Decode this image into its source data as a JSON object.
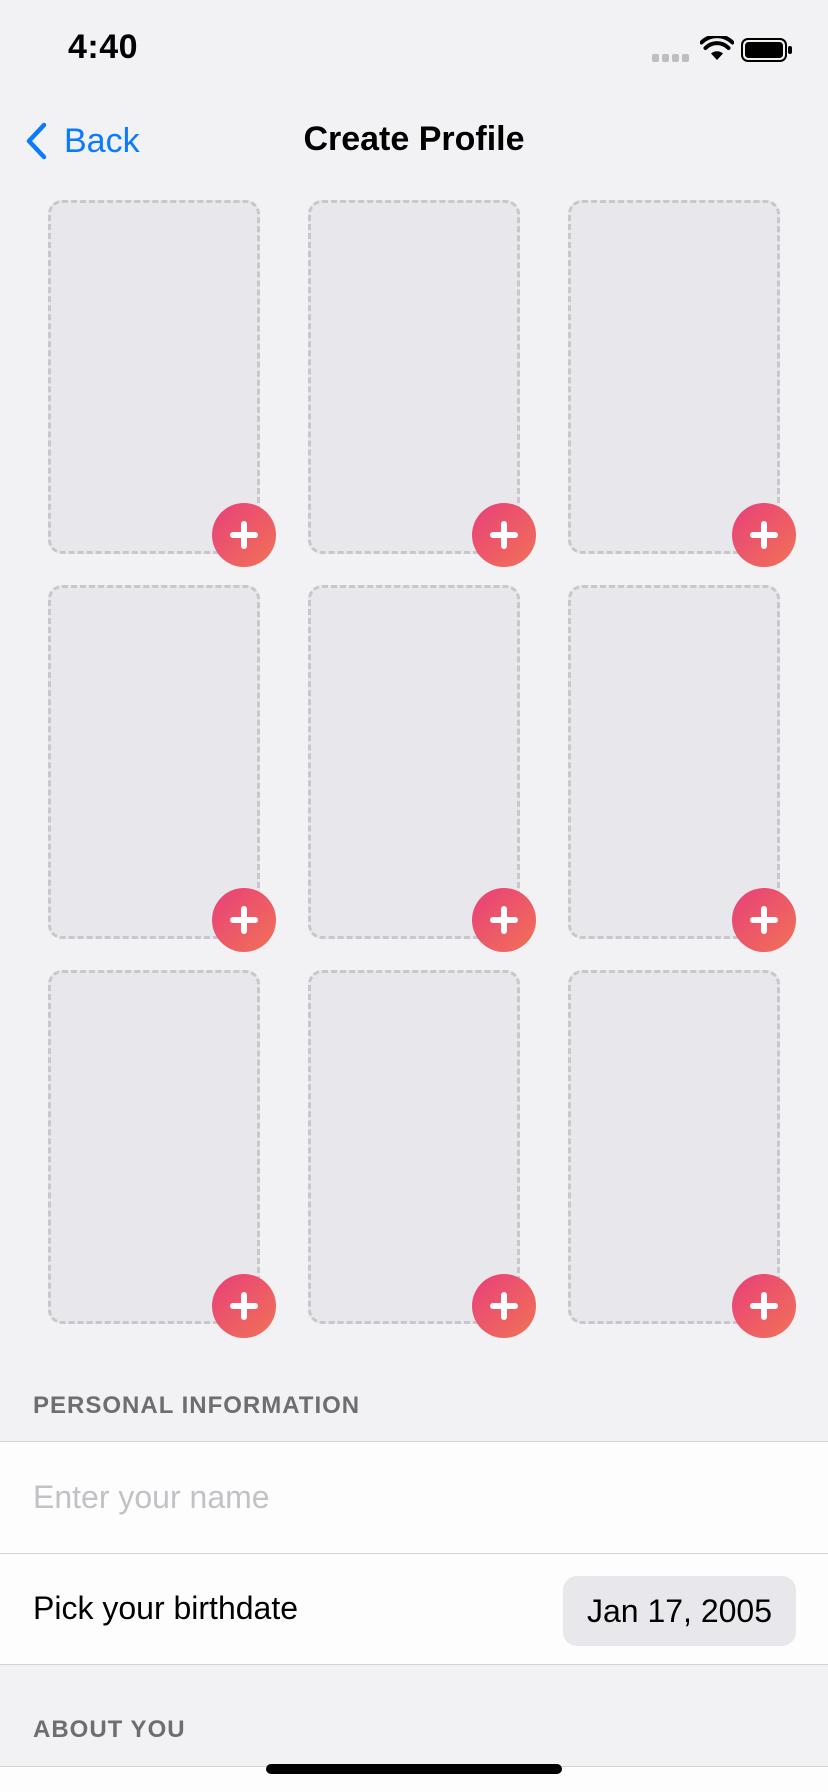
{
  "status_bar": {
    "time": "4:40"
  },
  "nav": {
    "back_label": "Back",
    "title": "Create Profile"
  },
  "photo_grid": {
    "slot_count": 9,
    "add_button_colors": [
      "#e83f7a",
      "#f17256"
    ]
  },
  "personal_information": {
    "header": "PERSONAL INFORMATION",
    "name_placeholder": "Enter your name",
    "name_value": "",
    "birthdate_label": "Pick your birthdate",
    "birthdate_value": "Jan 17, 2005"
  },
  "about_you": {
    "header": "ABOUT YOU"
  },
  "colors": {
    "accent": "#0a7aff",
    "background": "#f2f2f4"
  }
}
